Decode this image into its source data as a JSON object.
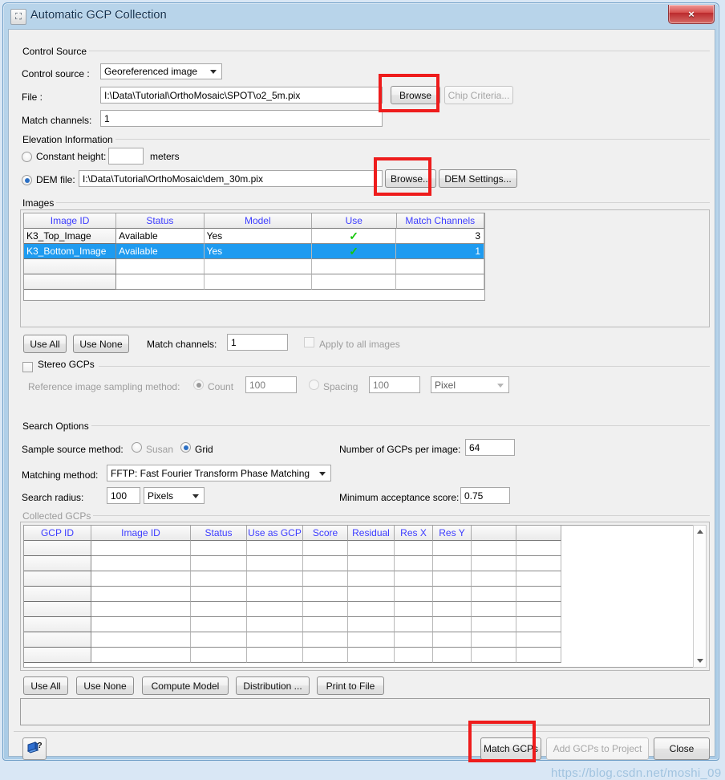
{
  "window": {
    "title": "Automatic GCP Collection",
    "icon": "app-icon",
    "close_label": "×"
  },
  "control_source": {
    "group_label": "Control Source",
    "source_label": "Control source :",
    "source_value": "Georeferenced image",
    "file_label": "File :",
    "file_value": "I:\\Data\\Tutorial\\OrthoMosaic\\SPOT\\o2_5m.pix",
    "browse_label": "Browse",
    "chip_criteria_label": "Chip Criteria...",
    "match_channels_label": "Match channels:",
    "match_channels_value": "1"
  },
  "elevation": {
    "group_label": "Elevation Information",
    "constant_height_label": "Constant height:",
    "constant_height_value": "",
    "meters_label": "meters",
    "dem_file_label": "DEM file:",
    "dem_file_value": "I:\\Data\\Tutorial\\OrthoMosaic\\dem_30m.pix",
    "browse_label": "Browse...",
    "dem_settings_label": "DEM Settings..."
  },
  "images": {
    "group_label": "Images",
    "columns": [
      "Image ID",
      "Status",
      "Model",
      "Use",
      "Match Channels"
    ],
    "rows": [
      {
        "image_id": "K3_Top_Image",
        "status": "Available",
        "model": "Yes",
        "use": "✓",
        "match_channels": "3",
        "selected": false
      },
      {
        "image_id": "K3_Bottom_Image",
        "status": "Available",
        "model": "Yes",
        "use": "✓",
        "match_channels": "1",
        "selected": true
      },
      {
        "image_id": "",
        "status": "",
        "model": "",
        "use": "",
        "match_channels": "",
        "selected": false
      },
      {
        "image_id": "",
        "status": "",
        "model": "",
        "use": "",
        "match_channels": "",
        "selected": false
      }
    ],
    "use_all_label": "Use All",
    "use_none_label": "Use None",
    "match_channels_label": "Match channels:",
    "match_channels_value": "1",
    "apply_all_label": "Apply to all images"
  },
  "stereo": {
    "group_label": "Stereo GCPs",
    "ref_sampling_label": "Reference image sampling method:",
    "count_label": "Count",
    "count_value": "100",
    "spacing_label": "Spacing",
    "spacing_value": "100",
    "unit_value": "Pixel"
  },
  "search_options": {
    "group_label": "Search Options",
    "sample_source_label": "Sample source method:",
    "susan_label": "Susan",
    "grid_label": "Grid",
    "num_gcps_label": "Number of GCPs per image:",
    "num_gcps_value": "64",
    "matching_method_label": "Matching method:",
    "matching_method_value": "FFTP: Fast Fourier Transform Phase Matching",
    "search_radius_label": "Search radius:",
    "search_radius_value": "100",
    "search_radius_unit": "Pixels",
    "min_score_label": "Minimum acceptance score:",
    "min_score_value": "0.75"
  },
  "collected_gcps": {
    "group_label": "Collected GCPs",
    "columns": [
      "GCP ID",
      "Image ID",
      "Status",
      "Use as GCP",
      "Score",
      "Residual",
      "Res X",
      "Res Y",
      "",
      ""
    ],
    "row_count": 8,
    "use_all_label": "Use All",
    "use_none_label": "Use None",
    "compute_model_label": "Compute Model",
    "distribution_label": "Distribution ...",
    "print_to_file_label": "Print to File",
    "status_text": ""
  },
  "footer": {
    "help_icon": "help-book-icon",
    "match_gcps_label": "Match GCPs",
    "add_gcps_label": "Add GCPs to Project",
    "close_label": "Close"
  },
  "watermark": {
    "text": "https://blog.csdn.net/moshi_09"
  },
  "colors": {
    "accent": "#1e9bf0",
    "header_text": "#3c3cff",
    "annotation": "#ee1c1c",
    "checkmark": "#16c60c",
    "title_text": "#14304d"
  }
}
